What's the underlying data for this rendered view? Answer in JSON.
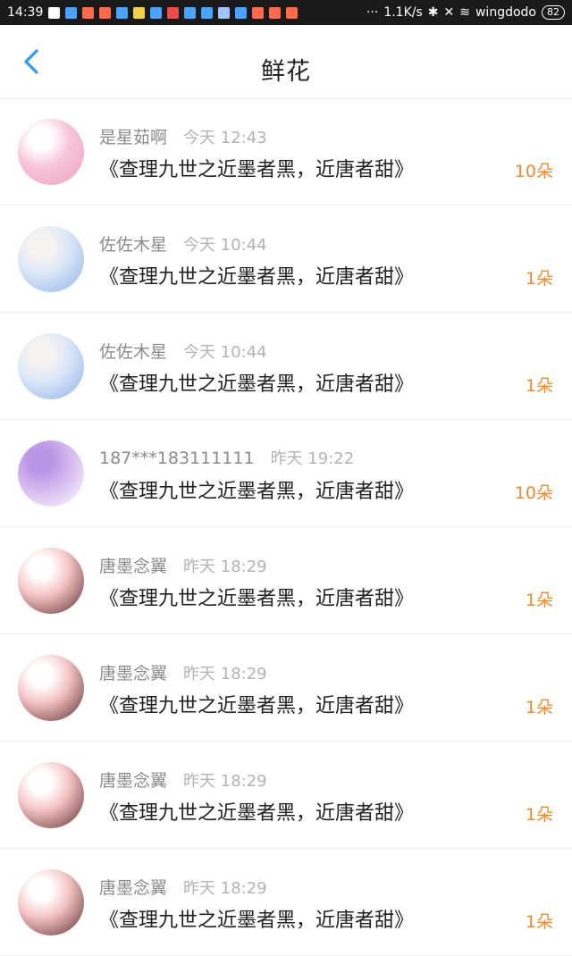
{
  "status_bar": {
    "time": "14:39",
    "network_speed": "1.1K/s",
    "wifi_name": "wingdodo",
    "battery": "82",
    "dots": "···"
  },
  "header": {
    "title": "鲜花",
    "back_icon": "chevron-left-icon"
  },
  "rows": [
    {
      "name": "是星茹啊",
      "time": "今天 12:43",
      "book": "《查理九世之近墨者黑，近唐者甜》",
      "count": "10朵",
      "avatar_colors": [
        "#f7c6d8",
        "#e9a2c1",
        "#ffffff"
      ]
    },
    {
      "name": "佐佐木星",
      "time": "今天 10:44",
      "book": "《查理九世之近墨者黑，近唐者甜》",
      "count": "1朵",
      "avatar_colors": [
        "#dbe7f8",
        "#8fb2e8",
        "#f7f3f1"
      ]
    },
    {
      "name": "佐佐木星",
      "time": "今天 10:44",
      "book": "《查理九世之近墨者黑，近唐者甜》",
      "count": "1朵",
      "avatar_colors": [
        "#dbe7f8",
        "#8fb2e8",
        "#f7f3f1"
      ]
    },
    {
      "name": "187***183111111",
      "time": "昨天 19:22",
      "book": "《查理九世之近墨者黑，近唐者甜》",
      "count": "10朵",
      "avatar_colors": [
        "#d2b6ee",
        "#ffffff",
        "#b895e6"
      ]
    },
    {
      "name": "唐墨念翼",
      "time": "昨天 18:29",
      "book": "《查理九世之近墨者黑，近唐者甜》",
      "count": "1朵",
      "avatar_colors": [
        "#f4c3c5",
        "#5b2d2a",
        "#ffffff"
      ]
    },
    {
      "name": "唐墨念翼",
      "time": "昨天 18:29",
      "book": "《查理九世之近墨者黑，近唐者甜》",
      "count": "1朵",
      "avatar_colors": [
        "#f4c3c5",
        "#5b2d2a",
        "#ffffff"
      ]
    },
    {
      "name": "唐墨念翼",
      "time": "昨天 18:29",
      "book": "《查理九世之近墨者黑，近唐者甜》",
      "count": "1朵",
      "avatar_colors": [
        "#f4c3c5",
        "#5b2d2a",
        "#ffffff"
      ]
    },
    {
      "name": "唐墨念翼",
      "time": "昨天 18:29",
      "book": "《查理九世之近墨者黑，近唐者甜》",
      "count": "1朵",
      "avatar_colors": [
        "#f4c3c5",
        "#5b2d2a",
        "#ffffff"
      ]
    }
  ]
}
